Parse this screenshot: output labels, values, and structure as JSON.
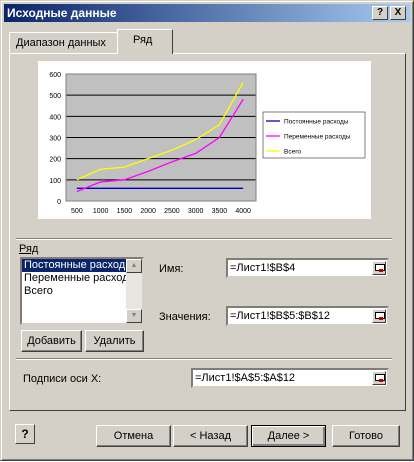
{
  "window": {
    "title": "Исходные данные",
    "help_btn": "?",
    "close_btn": "X"
  },
  "tabs": [
    {
      "label": "Диапазон данных"
    },
    {
      "label": "Ряд"
    }
  ],
  "chart_data": {
    "type": "line",
    "x": [
      500,
      1000,
      1500,
      2000,
      2500,
      3000,
      3500,
      4000
    ],
    "ylim": [
      0,
      600
    ],
    "yticks": [
      0,
      100,
      200,
      300,
      400,
      500,
      600
    ],
    "series": [
      {
        "name": "Постоянные расходы",
        "color": "#0000c0",
        "values": [
          60,
          60,
          60,
          60,
          60,
          60,
          60,
          60
        ]
      },
      {
        "name": "Переменные расходы",
        "color": "#ff00ff",
        "values": [
          45,
          90,
          100,
          140,
          185,
          225,
          300,
          480
        ]
      },
      {
        "name": "Всего",
        "color": "#ffff00",
        "values": [
          100,
          150,
          160,
          200,
          240,
          290,
          360,
          560
        ]
      }
    ],
    "legend_position": "right",
    "grid": "horizontal"
  },
  "series_group": {
    "label": "Ряд",
    "items": [
      "Постоянные расход",
      "Переменные расход",
      "Всего"
    ],
    "add": "Добавить",
    "remove": "Удалить"
  },
  "name_field": {
    "label": "Имя:",
    "value": "=Лист1!$B$4"
  },
  "values_field": {
    "label": "Значения:",
    "value": "=Лист1!$B$5:$B$12"
  },
  "xaxis_field": {
    "label": "Подписи оси X:",
    "value": "=Лист1!$A$5:$A$12"
  },
  "footer": {
    "cancel": "Отмена",
    "back": "< Назад",
    "next": "Далее >",
    "finish": "Готово"
  }
}
